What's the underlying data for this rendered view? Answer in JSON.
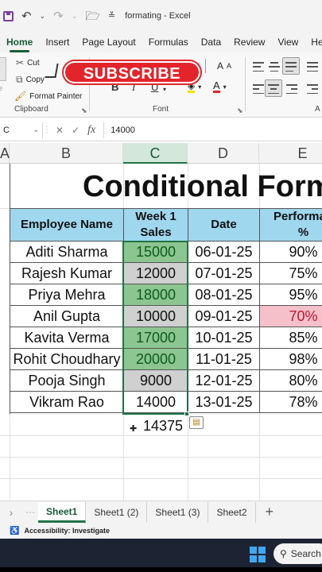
{
  "window": {
    "title": "formating - Excel",
    "icons": [
      "save-icon",
      "undo-icon",
      "redo-icon",
      "open-folder-icon",
      "customize-dropdown-icon"
    ]
  },
  "menu": {
    "tabs": [
      "Home",
      "Insert",
      "Page Layout",
      "Formulas",
      "Data",
      "Review",
      "View",
      "Help"
    ],
    "active": "Home"
  },
  "ribbon": {
    "cut_label": "Cut",
    "copy_label": "Copy",
    "format_painter_label": "Format Painter",
    "clipboard_label": "Clipboard",
    "font_label": "Font",
    "alignment_label": "A",
    "font_buttons": [
      "B",
      "I",
      "U"
    ],
    "font_size_buttons": [
      "A",
      "A"
    ],
    "overlay_text": "SUBSCRIBE",
    "overlay_color": "#e3242b"
  },
  "formula_bar": {
    "name_box": "C",
    "fx_label": "fx",
    "value": "14000"
  },
  "columns": [
    "A",
    "B",
    "C",
    "D",
    "E"
  ],
  "selected_column": "C",
  "sheet": {
    "title": "Conditional Form",
    "headers": [
      "Employee Name",
      "Week 1 Sales",
      "Date",
      "Performan %"
    ],
    "header_lines": [
      [
        "Employee Name"
      ],
      [
        "Week 1",
        "Sales"
      ],
      [
        "Date"
      ],
      [
        "Performan",
        "%"
      ]
    ],
    "rows": [
      {
        "name": "Aditi Sharma",
        "sales": "15000",
        "date": "06-01-25",
        "perf": "90%",
        "sales_style": "green",
        "perf_style": ""
      },
      {
        "name": "Rajesh Kumar",
        "sales": "12000",
        "date": "07-01-25",
        "perf": "75%",
        "sales_style": "gray",
        "perf_style": ""
      },
      {
        "name": "Priya Mehra",
        "sales": "18000",
        "date": "08-01-25",
        "perf": "95%",
        "sales_style": "green",
        "perf_style": ""
      },
      {
        "name": "Anil Gupta",
        "sales": "10000",
        "date": "09-01-25",
        "perf": "70%",
        "sales_style": "gray",
        "perf_style": "pink"
      },
      {
        "name": "Kavita Verma",
        "sales": "17000",
        "date": "10-01-25",
        "perf": "85%",
        "sales_style": "green",
        "perf_style": ""
      },
      {
        "name": "Rohit Choudhary",
        "sales": "20000",
        "date": "11-01-25",
        "perf": "98%",
        "sales_style": "green",
        "perf_style": ""
      },
      {
        "name": "Pooja Singh",
        "sales": "9000",
        "date": "12-01-25",
        "perf": "80%",
        "sales_style": "gray",
        "perf_style": ""
      },
      {
        "name": "Vikram Rao",
        "sales": "14000",
        "date": "13-01-25",
        "perf": "78%",
        "sales_style": "",
        "perf_style": ""
      }
    ],
    "average": "14375",
    "colors": {
      "header_fill": "#9fd8ee",
      "high_fill": "#8cc58f",
      "low_fill": "#d0d0d0",
      "alert_fill": "#f6c0cb",
      "accent": "#217346"
    }
  },
  "sheet_tabs": [
    "Sheet1",
    "Sheet1 (2)",
    "Sheet1 (3)",
    "Sheet2"
  ],
  "active_sheet": "Sheet1",
  "status": {
    "accessibility": "Accessibility: Investigate"
  },
  "taskbar": {
    "search_label": "Search"
  }
}
